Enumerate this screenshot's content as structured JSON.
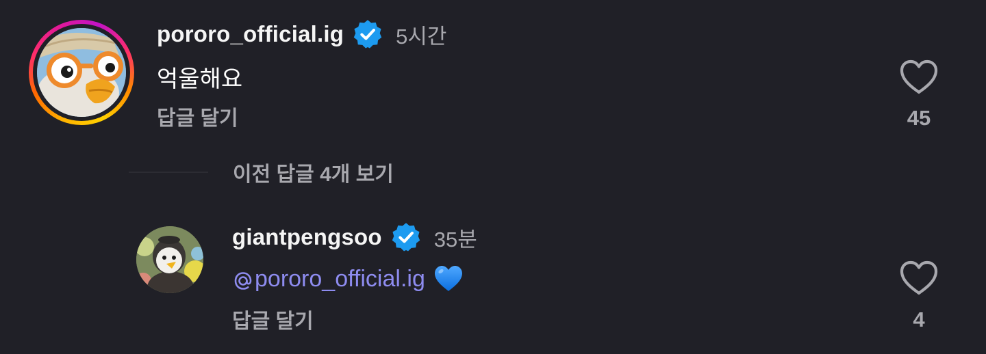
{
  "comments": [
    {
      "username": "pororo_official.ig",
      "verified": true,
      "time": "5시간",
      "text": "억울해요",
      "reply_label": "답글 달기",
      "likes": "45"
    }
  ],
  "view_previous_replies": "이전 답글 4개 보기",
  "replies": [
    {
      "username": "giantpengsoo",
      "verified": true,
      "time": "35분",
      "mention": "pororo_official.ig",
      "emoji": "💙",
      "reply_label": "답글 달기",
      "likes": "4"
    }
  ],
  "colors": {
    "background": "#202027",
    "secondary_text": "#a8a8ae",
    "mention": "#8e8cf0",
    "verified_badge": "#1d9bf0"
  },
  "icons": {
    "verified": "verified-badge-icon",
    "like": "heart-outline-icon",
    "mention": "at-sign-icon"
  }
}
